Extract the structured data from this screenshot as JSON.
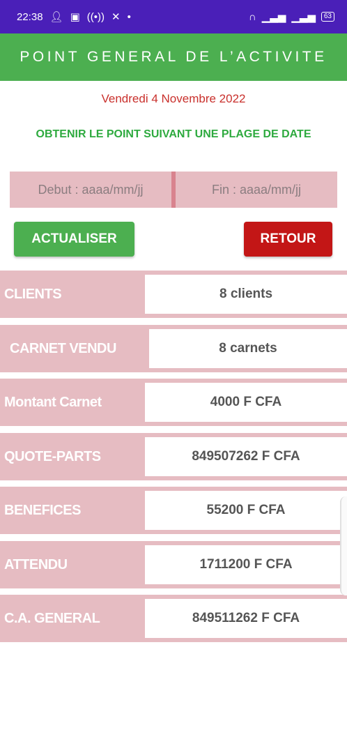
{
  "status_bar": {
    "time": "22:38",
    "battery": "63",
    "icons": [
      "person-add-icon",
      "gamepad-icon",
      "hotspot-icon",
      "x-icon",
      "dot-icon",
      "headset-icon",
      "signal-icon",
      "signal-icon",
      "battery-icon"
    ]
  },
  "app_bar": {
    "title": "POINT GENERAL DE L’ACTIVITE"
  },
  "date_line": "Vendredi 4 Novembre 2022",
  "range_line": "OBTENIR LE POINT SUIVANT UNE PLAGE DE DATE",
  "inputs": {
    "start_placeholder": "Debut : aaaa/mm/jj",
    "end_placeholder": "Fin : aaaa/mm/jj"
  },
  "buttons": {
    "refresh": "ACTUALISER",
    "back": "RETOUR"
  },
  "stats": [
    {
      "label": "CLIENTS",
      "value": "8 clients"
    },
    {
      "label": "CARNET VENDU",
      "value": "8 carnets"
    },
    {
      "label": "Montant Carnet",
      "value": "4000 F CFA"
    },
    {
      "label": "QUOTE-PARTS",
      "value": "849507262 F CFA"
    },
    {
      "label": "BENEFICES",
      "value": "55200 F CFA"
    },
    {
      "label": "ATTENDU",
      "value": "1711200 F CFA"
    },
    {
      "label": "C.A. GENERAL",
      "value": "849511262 F CFA"
    }
  ],
  "colors": {
    "status_bar": "#4a1fb8",
    "app_bar": "#4caf50",
    "date_text": "#c9302c",
    "range_text": "#2eaa3f",
    "row_background": "#e6bcc2",
    "refresh_button": "#4caf50",
    "back_button": "#c31616"
  }
}
